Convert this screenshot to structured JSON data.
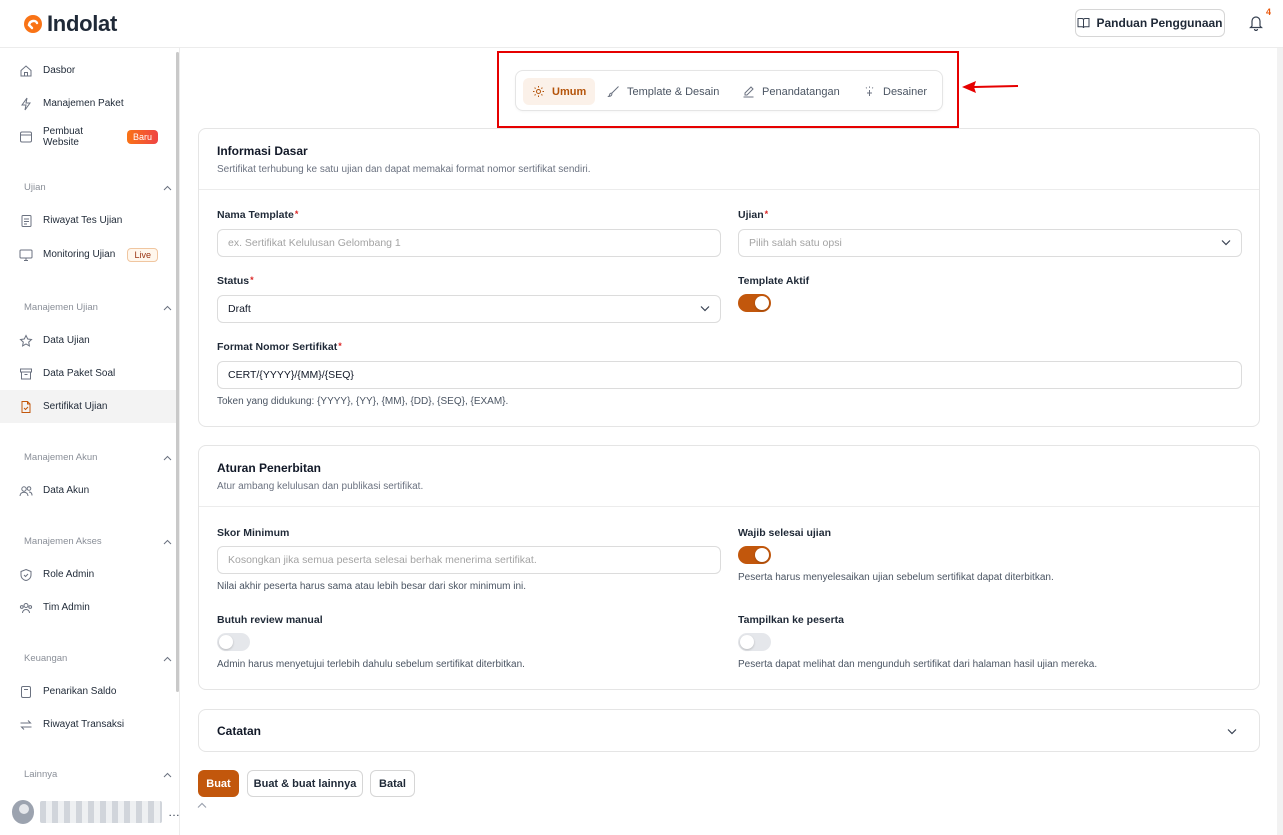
{
  "brand": {
    "name": "Indolat",
    "accent": "#c2570c",
    "logo_color": "#f97316"
  },
  "header": {
    "guide_label": "Panduan Penggunaan",
    "notification_count": "4"
  },
  "sidebar": {
    "top_items": [
      {
        "label": "Dasbor",
        "icon": "home-icon"
      },
      {
        "label": "Manajemen Paket",
        "icon": "bolt-icon"
      },
      {
        "label": "Pembuat Website",
        "icon": "window-icon",
        "badge": "Baru"
      }
    ],
    "groups": [
      {
        "label": "Ujian",
        "items": [
          {
            "label": "Riwayat Tes Ujian",
            "icon": "file-list-icon"
          },
          {
            "label": "Monitoring Ujian",
            "icon": "monitor-icon",
            "badge": "Live"
          }
        ]
      },
      {
        "label": "Manajemen Ujian",
        "items": [
          {
            "label": "Data Ujian",
            "icon": "star-icon"
          },
          {
            "label": "Data Paket Soal",
            "icon": "archive-icon"
          },
          {
            "label": "Sertifikat Ujian",
            "icon": "certificate-icon",
            "active": true
          }
        ]
      },
      {
        "label": "Manajemen Akun",
        "items": [
          {
            "label": "Data Akun",
            "icon": "users-icon"
          }
        ]
      },
      {
        "label": "Manajemen Akses",
        "items": [
          {
            "label": "Role Admin",
            "icon": "shield-icon"
          },
          {
            "label": "Tim Admin",
            "icon": "team-icon"
          }
        ]
      },
      {
        "label": "Keuangan",
        "items": [
          {
            "label": "Penarikan Saldo",
            "icon": "wallet-icon"
          },
          {
            "label": "Riwayat Transaksi",
            "icon": "transfer-icon"
          }
        ]
      },
      {
        "label": "Lainnya",
        "items": []
      }
    ]
  },
  "tabs": [
    {
      "label": "Umum",
      "icon": "gear-icon",
      "active": true
    },
    {
      "label": "Template & Desain",
      "icon": "brush-icon"
    },
    {
      "label": "Penandatangan",
      "icon": "pen-icon"
    },
    {
      "label": "Desainer",
      "icon": "sparkle-icon"
    }
  ],
  "info_card": {
    "title": "Informasi Dasar",
    "desc": "Sertifikat terhubung ke satu ujian dan dapat memakai format nomor sertifikat sendiri.",
    "name_label": "Nama Template",
    "name_placeholder": "ex. Sertifikat Kelulusan Gelombang 1",
    "exam_label": "Ujian",
    "exam_placeholder": "Pilih salah satu opsi",
    "status_label": "Status",
    "status_value": "Draft",
    "active_label": "Template Aktif",
    "active_on": true,
    "format_label": "Format Nomor Sertifikat",
    "format_value": "CERT/{YYYY}/{MM}/{SEQ}",
    "format_help": "Token yang didukung: {YYYY}, {YY}, {MM}, {DD}, {SEQ}, {EXAM}."
  },
  "rules_card": {
    "title": "Aturan Penerbitan",
    "desc": "Atur ambang kelulusan dan publikasi sertifikat.",
    "min_score_label": "Skor Minimum",
    "min_score_placeholder": "Kosongkan jika semua peserta selesai berhak menerima sertifikat.",
    "min_score_help": "Nilai akhir peserta harus sama atau lebih besar dari skor minimum ini.",
    "must_finish_label": "Wajib selesai ujian",
    "must_finish_on": true,
    "must_finish_help": "Peserta harus menyelesaikan ujian sebelum sertifikat dapat diterbitkan.",
    "review_label": "Butuh review manual",
    "review_on": false,
    "review_help": "Admin harus menyetujui terlebih dahulu sebelum sertifikat diterbitkan.",
    "show_label": "Tampilkan ke peserta",
    "show_on": false,
    "show_help": "Peserta dapat melihat dan mengunduh sertifikat dari halaman hasil ujian mereka."
  },
  "notes_card": {
    "title": "Catatan"
  },
  "actions": {
    "create": "Buat",
    "create_more": "Buat & buat lainnya",
    "cancel": "Batal"
  },
  "required_mark": "*"
}
